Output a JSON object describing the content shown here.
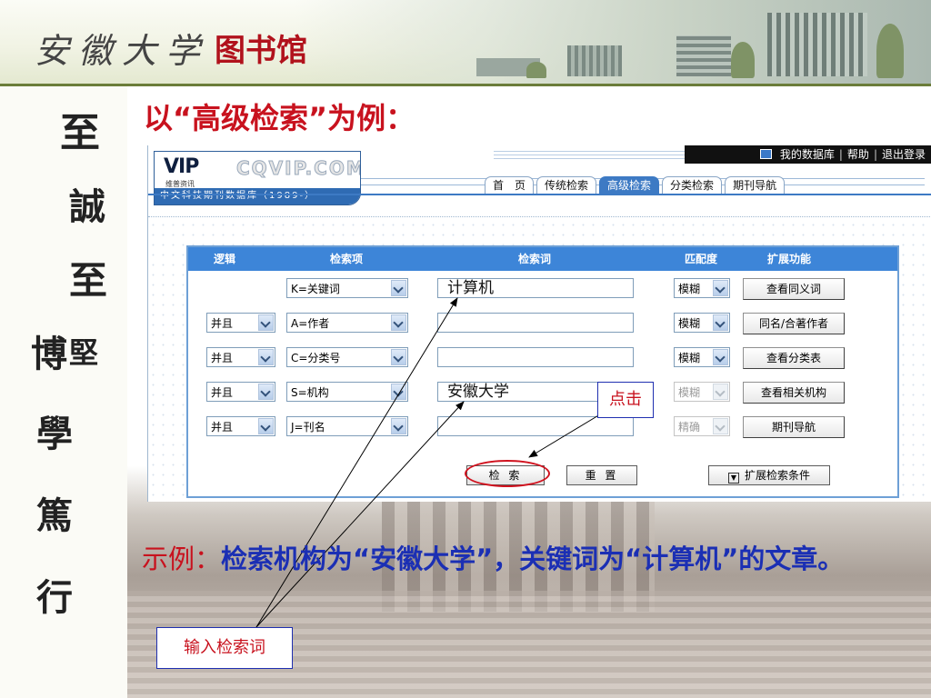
{
  "slide": {
    "header_title_handwritten": "安徽大学",
    "header_title_library": "图书馆",
    "motto_chars": [
      "至",
      "誠",
      "至",
      "堅",
      "博",
      "學",
      "篤",
      "行"
    ],
    "section_title": "以“高级检索”为例："
  },
  "vip": {
    "logo_mark": "VIP",
    "logo_sub": "维普资讯",
    "logo_cqvip": "CQVIP.COM",
    "db_name": "中文科技期刊数据库（1989-）",
    "top_links": [
      "我的数据库",
      "帮助",
      "退出登录"
    ],
    "tabs": [
      "首　页",
      "传统检索",
      "高级检索",
      "分类检索",
      "期刊导航"
    ],
    "active_tab": "高级检索",
    "table_headers": {
      "logic": "逻辑",
      "field": "检索项",
      "term": "检索词",
      "match": "匹配度",
      "ext": "扩展功能"
    },
    "rows": [
      {
        "logic": "",
        "field": "K=关键词",
        "term": "计算机",
        "match": "模糊",
        "match_disabled": false,
        "ext": "查看同义词"
      },
      {
        "logic": "并且",
        "field": "A=作者",
        "term": "",
        "match": "模糊",
        "match_disabled": false,
        "ext": "同名/合著作者"
      },
      {
        "logic": "并且",
        "field": "C=分类号",
        "term": "",
        "match": "模糊",
        "match_disabled": false,
        "ext": "查看分类表"
      },
      {
        "logic": "并且",
        "field": "S=机构",
        "term": "安徽大学",
        "match": "模糊",
        "match_disabled": true,
        "ext": "查看相关机构"
      },
      {
        "logic": "并且",
        "field": "J=刊名",
        "term": "",
        "match": "精确",
        "match_disabled": true,
        "ext": "期刊导航"
      }
    ],
    "search_button": "检 索",
    "reset_button": "重 置",
    "expand_button": "扩展检索条件"
  },
  "annotations": {
    "click_label": "点击",
    "input_label": "输入检索词",
    "accent_color": "#c8121e",
    "blue_text_color": "#1b2fb4"
  },
  "example": {
    "label": "示例：",
    "text": "检索机构为“安徽大学”，关键词为“计算机”的文章。"
  }
}
